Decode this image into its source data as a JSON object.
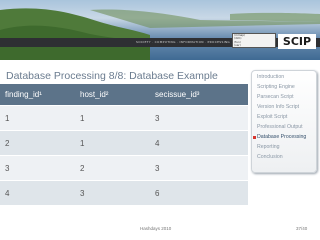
{
  "header": {
    "logo_text": "SCIP",
    "strip_text": "SOCIETY · COMPUTING · INFORMATION · PROCESSING",
    "box_lines": [
      "(mmap)",
      "(dim)",
      "(fun)",
      "(var)"
    ]
  },
  "slide": {
    "title": "Database Processing 8/8: Database Example"
  },
  "table": {
    "columns": [
      "finding_id¹",
      "host_id²",
      "secissue_id³"
    ],
    "rows": [
      [
        "1",
        "1",
        "3"
      ],
      [
        "2",
        "1",
        "4"
      ],
      [
        "3",
        "2",
        "3"
      ],
      [
        "4",
        "3",
        "6"
      ]
    ]
  },
  "nav": {
    "items": [
      {
        "label": "Introduction",
        "active": false
      },
      {
        "label": "Scripting Engine",
        "active": false
      },
      {
        "label": "Parsecan Script",
        "active": false
      },
      {
        "label": "Version Info Script",
        "active": false
      },
      {
        "label": "Exploit Script",
        "active": false
      },
      {
        "label": "Professional Output",
        "active": false
      },
      {
        "label": "Database Processing",
        "active": true
      },
      {
        "label": "Reporting",
        "active": false
      },
      {
        "label": "Conclusion",
        "active": false
      }
    ],
    "bullet_color": "#d6362e"
  },
  "footer": {
    "date": "Hashdays 2010",
    "page": "37/40"
  }
}
